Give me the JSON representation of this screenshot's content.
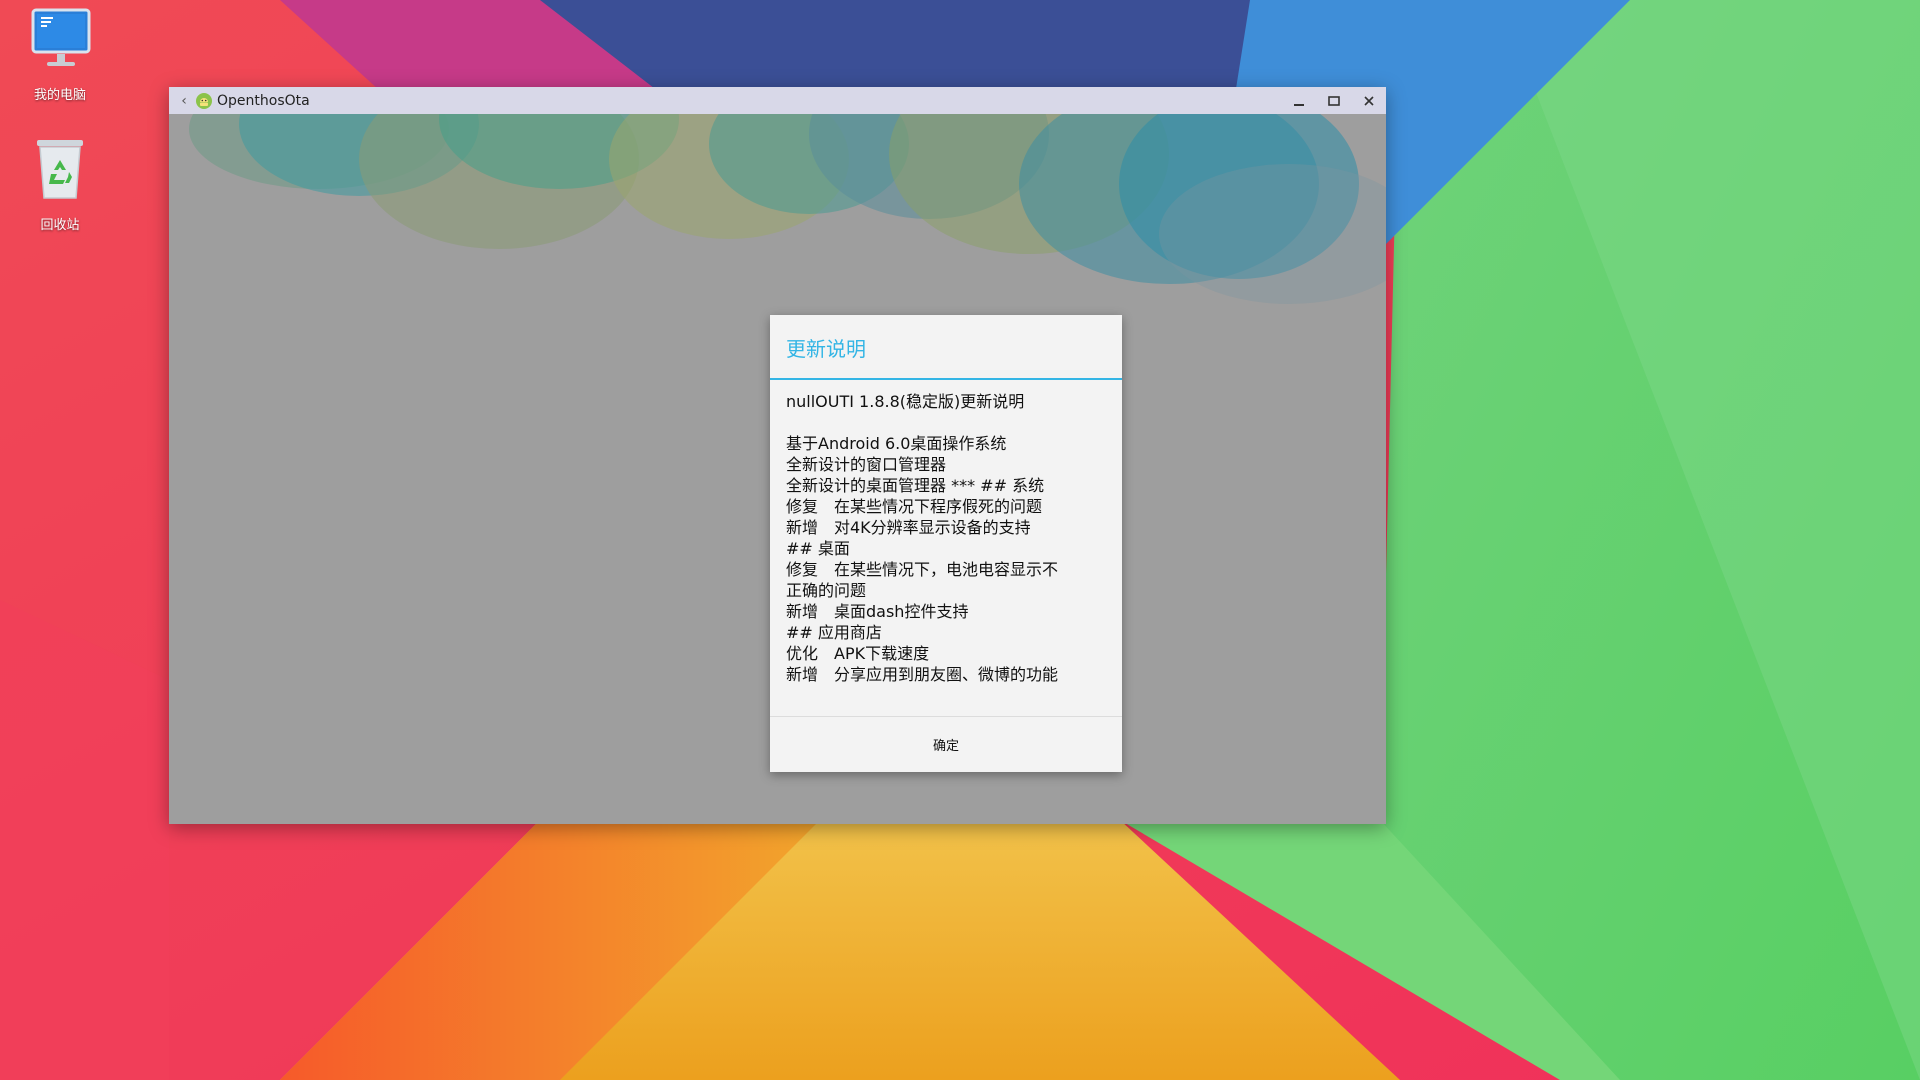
{
  "desktop": {
    "icons": [
      {
        "label": "我的电脑",
        "icon": "computer-icon"
      },
      {
        "label": "回收站",
        "icon": "recycle-bin-icon"
      }
    ]
  },
  "window": {
    "title": "OpenthosOta",
    "app_icon": "android-icon",
    "controls": [
      "back-icon",
      "minimize-icon",
      "maximize-icon",
      "close-icon"
    ]
  },
  "dialog": {
    "title": "更新说明",
    "lines": [
      "nullOUTI 1.8.8(稳定版)更新说明",
      "",
      "基于Android 6.0桌面操作系统",
      "全新设计的窗口管理器",
      "全新设计的桌面管理器 *** ## 系统",
      "修复　在某些情况下程序假死的问题",
      "新增　对4K分辨率显示设备的支持",
      "## 桌面",
      "修复　在某些情况下，电池电容显示不",
      "正确的问题",
      "新增　桌面dash控件支持",
      "## 应用商店",
      "优化　APK下载速度",
      "新增　分享应用到朋友圈、微博的功能"
    ],
    "ok_label": "确定"
  },
  "colors": {
    "accent": "#33b5e5",
    "titlebar": "#d8d8e8",
    "window_bg": "#9e9e9e",
    "dialog_bg": "#f3f3f3"
  }
}
